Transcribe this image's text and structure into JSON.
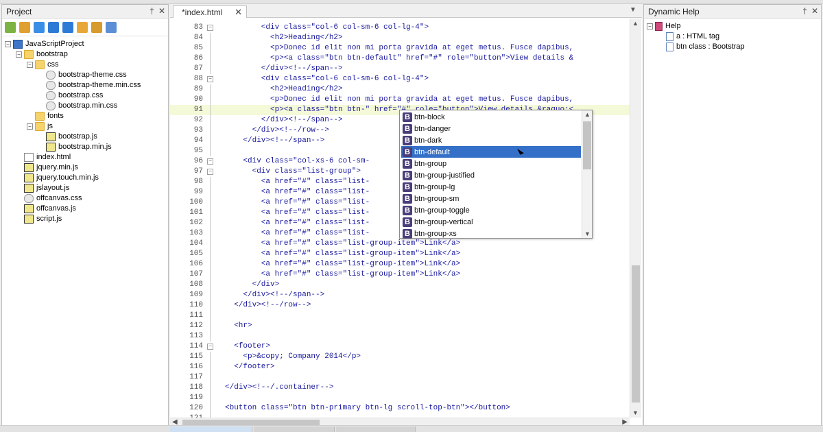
{
  "project_panel": {
    "title": "Project",
    "pin": "†",
    "close": "✕",
    "tree": [
      {
        "depth": 0,
        "type": "project",
        "label": "JavaScriptProject",
        "toggle": "−"
      },
      {
        "depth": 1,
        "type": "folder",
        "label": "bootstrap",
        "toggle": "−"
      },
      {
        "depth": 2,
        "type": "folder",
        "label": "css",
        "toggle": "−"
      },
      {
        "depth": 3,
        "type": "css",
        "label": "bootstrap-theme.css"
      },
      {
        "depth": 3,
        "type": "css",
        "label": "bootstrap-theme.min.css"
      },
      {
        "depth": 3,
        "type": "css",
        "label": "bootstrap.css"
      },
      {
        "depth": 3,
        "type": "css",
        "label": "bootstrap.min.css"
      },
      {
        "depth": 2,
        "type": "folder",
        "label": "fonts"
      },
      {
        "depth": 2,
        "type": "folder",
        "label": "js",
        "toggle": "−"
      },
      {
        "depth": 3,
        "type": "js",
        "label": "bootstrap.js"
      },
      {
        "depth": 3,
        "type": "js",
        "label": "bootstrap.min.js"
      },
      {
        "depth": 1,
        "type": "html",
        "label": "index.html"
      },
      {
        "depth": 1,
        "type": "js",
        "label": "jquery.min.js"
      },
      {
        "depth": 1,
        "type": "js",
        "label": "jquery.touch.min.js"
      },
      {
        "depth": 1,
        "type": "js",
        "label": "jslayout.js"
      },
      {
        "depth": 1,
        "type": "css",
        "label": "offcanvas.css"
      },
      {
        "depth": 1,
        "type": "js",
        "label": "offcanvas.js"
      },
      {
        "depth": 1,
        "type": "js",
        "label": "script.js"
      }
    ]
  },
  "toolbar_icons": [
    {
      "name": "add-file-icon",
      "color": "#7cb342"
    },
    {
      "name": "add-folder-icon",
      "color": "#e0a030"
    },
    {
      "name": "refresh-icon",
      "color": "#3a8ee6"
    },
    {
      "name": "settings-icon",
      "color": "#2e7bd6"
    },
    {
      "name": "upload-icon",
      "color": "#2e7bd6"
    },
    {
      "name": "network-icon",
      "color": "#e8a838"
    },
    {
      "name": "folder-open-icon",
      "color": "#d69a2d"
    },
    {
      "name": "document-icon",
      "color": "#5c8fd6"
    }
  ],
  "editor": {
    "tab_label": "*index.html",
    "tab_close": "✕",
    "tab_menu": "▼",
    "current_line": "91",
    "lines": [
      {
        "n": "83",
        "fold": "−",
        "text": "        <div class=\"col-6 col-sm-6 col-lg-4\">"
      },
      {
        "n": "84",
        "text": "          <h2>Heading</h2>"
      },
      {
        "n": "85",
        "text": "          <p>Donec id elit non mi porta gravida at eget metus. Fusce dapibus,"
      },
      {
        "n": "86",
        "text": "          <p><a class=\"btn btn-default\" href=\"#\" role=\"button\">View details &"
      },
      {
        "n": "87",
        "text": "        </div><!--/span-->"
      },
      {
        "n": "88",
        "fold": "−",
        "text": "        <div class=\"col-6 col-sm-6 col-lg-4\">"
      },
      {
        "n": "89",
        "text": "          <h2>Heading</h2>"
      },
      {
        "n": "90",
        "text": "          <p>Donec id elit non mi porta gravida at eget metus. Fusce dapibus,"
      },
      {
        "n": "91",
        "text": "          <p><a class=\"btn btn-\" href=\"#\" role=\"button\">View details &raquo;<"
      },
      {
        "n": "92",
        "text": "        </div><!--/span-->"
      },
      {
        "n": "93",
        "text": "      </div><!--/row-->"
      },
      {
        "n": "94",
        "text": "    </div><!--/span-->"
      },
      {
        "n": "95",
        "text": ""
      },
      {
        "n": "96",
        "fold": "−",
        "text": "    <div class=\"col-xs-6 col-sm-                                    ebar\" ro"
      },
      {
        "n": "97",
        "fold": "−",
        "text": "      <div class=\"list-group\">"
      },
      {
        "n": "98",
        "text": "        <a href=\"#\" class=\"list-"
      },
      {
        "n": "99",
        "text": "        <a href=\"#\" class=\"list-"
      },
      {
        "n": "100",
        "text": "        <a href=\"#\" class=\"list-"
      },
      {
        "n": "101",
        "text": "        <a href=\"#\" class=\"list-"
      },
      {
        "n": "102",
        "text": "        <a href=\"#\" class=\"list-"
      },
      {
        "n": "103",
        "text": "        <a href=\"#\" class=\"list-"
      },
      {
        "n": "104",
        "text": "        <a href=\"#\" class=\"list-group-item\">Link</a>"
      },
      {
        "n": "105",
        "text": "        <a href=\"#\" class=\"list-group-item\">Link</a>"
      },
      {
        "n": "106",
        "text": "        <a href=\"#\" class=\"list-group-item\">Link</a>"
      },
      {
        "n": "107",
        "text": "        <a href=\"#\" class=\"list-group-item\">Link</a>"
      },
      {
        "n": "108",
        "text": "      </div>"
      },
      {
        "n": "109",
        "text": "    </div><!--/span-->"
      },
      {
        "n": "110",
        "text": "  </div><!--/row-->"
      },
      {
        "n": "111",
        "text": ""
      },
      {
        "n": "112",
        "text": "  <hr>"
      },
      {
        "n": "113",
        "text": ""
      },
      {
        "n": "114",
        "fold": "−",
        "text": "  <footer>"
      },
      {
        "n": "115",
        "text": "    <p>&copy; Company 2014</p>"
      },
      {
        "n": "116",
        "text": "  </footer>"
      },
      {
        "n": "117",
        "text": ""
      },
      {
        "n": "118",
        "text": "</div><!--/.container-->"
      },
      {
        "n": "119",
        "text": ""
      },
      {
        "n": "120",
        "text": "<button class=\"btn btn-primary btn-lg scroll-top-btn\"></button>"
      },
      {
        "n": "121",
        "text": ""
      }
    ]
  },
  "autocomplete": {
    "selected": "btn-default",
    "icon_letter": "B",
    "items": [
      "btn-block",
      "btn-danger",
      "btn-dark",
      "btn-default",
      "btn-group",
      "btn-group-justified",
      "btn-group-lg",
      "btn-group-sm",
      "btn-group-toggle",
      "btn-group-vertical",
      "btn-group-xs"
    ]
  },
  "help_panel": {
    "title": "Dynamic Help",
    "pin": "†",
    "close": "✕",
    "tree": [
      {
        "depth": 0,
        "type": "book",
        "label": "Help",
        "toggle": "−"
      },
      {
        "depth": 1,
        "type": "doc",
        "label": "a : HTML tag"
      },
      {
        "depth": 1,
        "type": "doc",
        "label": "btn class : Bootstrap"
      }
    ]
  },
  "colors": {
    "tag": "#1a1a9e",
    "selection": "#3470c8",
    "current_line": "#f4f9d8",
    "bootstrap_icon": "#4a3d7a"
  }
}
